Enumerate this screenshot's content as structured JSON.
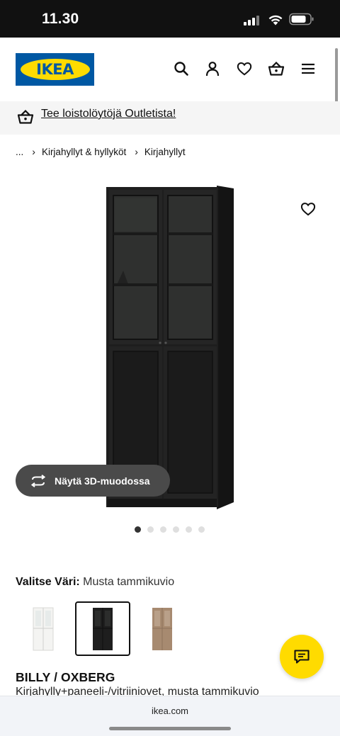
{
  "status_bar": {
    "time": "11.30"
  },
  "header": {
    "logo_text": "IKEA",
    "icons": [
      "search-icon",
      "account-icon",
      "heart-icon",
      "basket-icon",
      "menu-icon"
    ]
  },
  "promo": {
    "text": "Tee loistolöytöjä Outletista!",
    "icon": "basket-icon"
  },
  "breadcrumb": {
    "items": [
      "...",
      "Kirjahyllyt & hyllyköt",
      "Kirjahyllyt"
    ]
  },
  "gallery": {
    "view_3d_label": "Näytä 3D-muodossa",
    "dot_count": 6,
    "active_dot": 1
  },
  "color_select": {
    "label": "Valitse Väri:",
    "value": "Musta tammikuvio",
    "swatches": [
      "white",
      "black",
      "oak"
    ],
    "selected_index": 1
  },
  "product": {
    "name": "BILLY / OXBERG",
    "description": "Kirjahylly+paneeli-/vitriiniovet, musta tammikuvio"
  },
  "browser": {
    "url": "ikea.com"
  },
  "colors": {
    "ikea_blue": "#0058a3",
    "ikea_yellow": "#ffdb00",
    "product_dark": "#1c1c1c"
  }
}
